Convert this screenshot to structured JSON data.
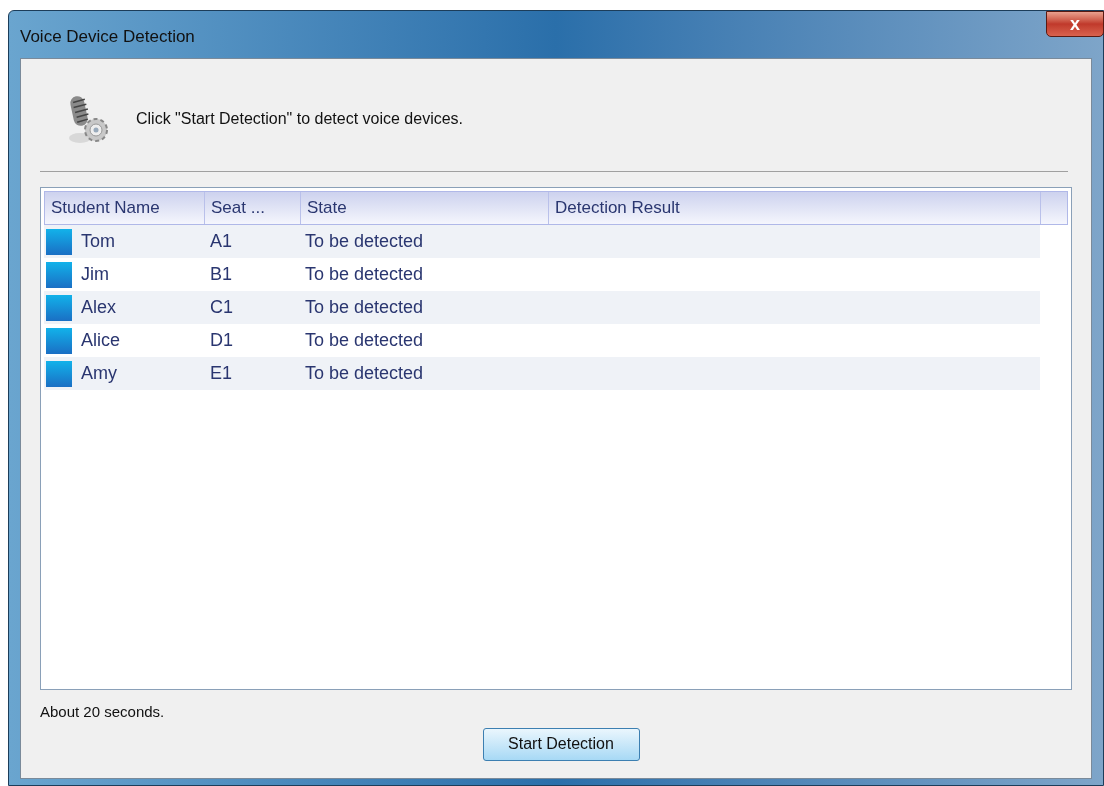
{
  "window": {
    "title": "Voice Device Detection"
  },
  "instruction": "Click \"Start Detection\" to detect voice devices.",
  "table": {
    "columns": [
      "Student Name",
      "Seat ...",
      "State",
      "Detection Result"
    ],
    "rows": [
      {
        "name": "Tom",
        "seat": "A1",
        "state": "To be detected"
      },
      {
        "name": "Jim",
        "seat": "B1",
        "state": "To be detected"
      },
      {
        "name": "Alex",
        "seat": "C1",
        "state": "To be detected"
      },
      {
        "name": "Alice",
        "seat": "D1",
        "state": "To be detected"
      },
      {
        "name": "Amy",
        "seat": "E1",
        "state": "To be detected"
      }
    ]
  },
  "status": "About 20 seconds.",
  "buttons": [
    {
      "label": "Start Detection"
    }
  ],
  "close_label": "x"
}
